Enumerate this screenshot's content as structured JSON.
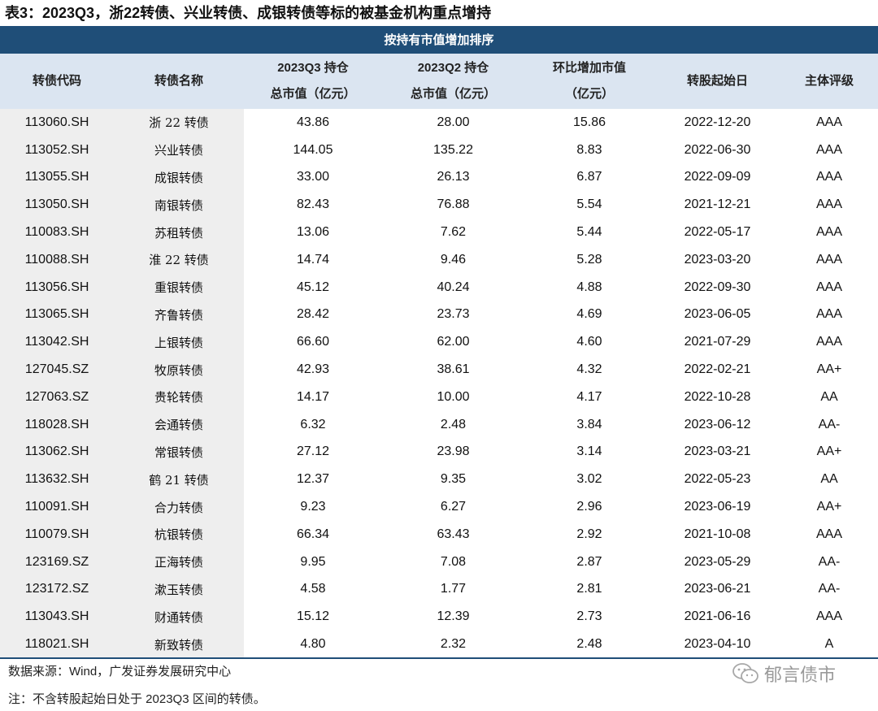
{
  "title": "表3：2023Q3，浙22转债、兴业转债、成银转债等标的被基金机构重点增持",
  "banner": "按持有市值增加排序",
  "headers": {
    "code": "转债代码",
    "name": "转债名称",
    "q3_line1": "2023Q3 持仓",
    "q3_line2": "总市值（亿元）",
    "q2_line1": "2023Q2 持仓",
    "q2_line2": "总市值（亿元）",
    "chg_line1": "环比增加市值",
    "chg_line2": "（亿元）",
    "start": "转股起始日",
    "rating": "主体评级"
  },
  "rows": [
    {
      "code": "113060.SH",
      "name": "浙 22 转债",
      "q3": "43.86",
      "q2": "28.00",
      "chg": "15.86",
      "start": "2022-12-20",
      "rating": "AAA"
    },
    {
      "code": "113052.SH",
      "name": "兴业转债",
      "q3": "144.05",
      "q2": "135.22",
      "chg": "8.83",
      "start": "2022-06-30",
      "rating": "AAA"
    },
    {
      "code": "113055.SH",
      "name": "成银转债",
      "q3": "33.00",
      "q2": "26.13",
      "chg": "6.87",
      "start": "2022-09-09",
      "rating": "AAA"
    },
    {
      "code": "113050.SH",
      "name": "南银转债",
      "q3": "82.43",
      "q2": "76.88",
      "chg": "5.54",
      "start": "2021-12-21",
      "rating": "AAA"
    },
    {
      "code": "110083.SH",
      "name": "苏租转债",
      "q3": "13.06",
      "q2": "7.62",
      "chg": "5.44",
      "start": "2022-05-17",
      "rating": "AAA"
    },
    {
      "code": "110088.SH",
      "name": "淮 22 转债",
      "q3": "14.74",
      "q2": "9.46",
      "chg": "5.28",
      "start": "2023-03-20",
      "rating": "AAA"
    },
    {
      "code": "113056.SH",
      "name": "重银转债",
      "q3": "45.12",
      "q2": "40.24",
      "chg": "4.88",
      "start": "2022-09-30",
      "rating": "AAA"
    },
    {
      "code": "113065.SH",
      "name": "齐鲁转债",
      "q3": "28.42",
      "q2": "23.73",
      "chg": "4.69",
      "start": "2023-06-05",
      "rating": "AAA"
    },
    {
      "code": "113042.SH",
      "name": "上银转债",
      "q3": "66.60",
      "q2": "62.00",
      "chg": "4.60",
      "start": "2021-07-29",
      "rating": "AAA"
    },
    {
      "code": "127045.SZ",
      "name": "牧原转债",
      "q3": "42.93",
      "q2": "38.61",
      "chg": "4.32",
      "start": "2022-02-21",
      "rating": "AA+"
    },
    {
      "code": "127063.SZ",
      "name": "贵轮转债",
      "q3": "14.17",
      "q2": "10.00",
      "chg": "4.17",
      "start": "2022-10-28",
      "rating": "AA"
    },
    {
      "code": "118028.SH",
      "name": "会通转债",
      "q3": "6.32",
      "q2": "2.48",
      "chg": "3.84",
      "start": "2023-06-12",
      "rating": "AA-"
    },
    {
      "code": "113062.SH",
      "name": "常银转债",
      "q3": "27.12",
      "q2": "23.98",
      "chg": "3.14",
      "start": "2023-03-21",
      "rating": "AA+"
    },
    {
      "code": "113632.SH",
      "name": "鹤 21 转债",
      "q3": "12.37",
      "q2": "9.35",
      "chg": "3.02",
      "start": "2022-05-23",
      "rating": "AA"
    },
    {
      "code": "110091.SH",
      "name": "合力转债",
      "q3": "9.23",
      "q2": "6.27",
      "chg": "2.96",
      "start": "2023-06-19",
      "rating": "AA+"
    },
    {
      "code": "110079.SH",
      "name": "杭银转债",
      "q3": "66.34",
      "q2": "63.43",
      "chg": "2.92",
      "start": "2021-10-08",
      "rating": "AAA"
    },
    {
      "code": "123169.SZ",
      "name": "正海转债",
      "q3": "9.95",
      "q2": "7.08",
      "chg": "2.87",
      "start": "2023-05-29",
      "rating": "AA-"
    },
    {
      "code": "123172.SZ",
      "name": "漱玉转债",
      "q3": "4.58",
      "q2": "1.77",
      "chg": "2.81",
      "start": "2023-06-21",
      "rating": "AA-"
    },
    {
      "code": "113043.SH",
      "name": "财通转债",
      "q3": "15.12",
      "q2": "12.39",
      "chg": "2.73",
      "start": "2021-06-16",
      "rating": "AAA"
    },
    {
      "code": "118021.SH",
      "name": "新致转债",
      "q3": "4.80",
      "q2": "2.32",
      "chg": "2.48",
      "start": "2023-04-10",
      "rating": "A"
    }
  ],
  "source": "数据来源：Wind，广发证券发展研究中心",
  "note": "注：不含转股起始日处于 2023Q3 区间的转债。",
  "watermark": "郁言债市",
  "watermark_icon": "wechat-icon"
}
